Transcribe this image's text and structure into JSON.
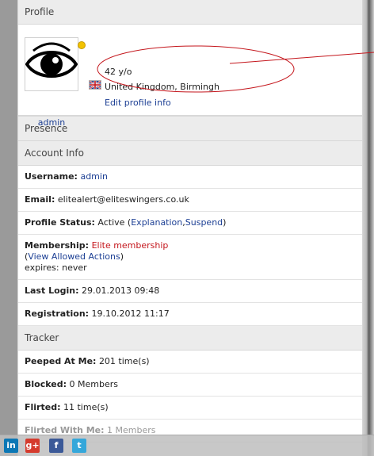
{
  "profile": {
    "header": "Profile",
    "username": "admin",
    "age": "42 y/o",
    "location": "United Kingdom, Birmingh",
    "edit_link": "Edit profile info"
  },
  "presence": {
    "header": "Presence"
  },
  "account": {
    "header": "Account Info",
    "username_label": "Username:",
    "username_value": "admin",
    "email_label": "Email:",
    "email_value": "elitealert@eliteswingers.co.uk",
    "status_label": "Profile Status:",
    "status_value": "Active (",
    "status_explanation": "Explanation",
    "status_comma": ",",
    "status_suspend": "Suspend",
    "status_close": ")",
    "membership_label": "Membership:",
    "membership_value": "Elite membership",
    "allowed_open": "(",
    "allowed_link": "View Allowed Actions",
    "allowed_close": ")",
    "expires": "expires: never",
    "last_login_label": "Last Login:",
    "last_login_value": "29.01.2013 09:48",
    "registration_label": "Registration:",
    "registration_value": "19.10.2012 11:17"
  },
  "tracker": {
    "header": "Tracker",
    "peeped_label": "Peeped At Me:",
    "peeped_value": "201 time(s)",
    "blocked_label": "Blocked:",
    "blocked_value": "0 Members",
    "flirted_label": "Flirted:",
    "flirted_value": "11 time(s)",
    "flirted_with_label": "Flirted With Me:",
    "flirted_with_value": "1 Members"
  },
  "share": {
    "icons": [
      "linkedin-icon",
      "google-plus-icon",
      "facebook-icon",
      "twitter-icon"
    ],
    "linkedin_text": "in",
    "gplus_text": "g+",
    "facebook_text": "f",
    "twitter_text": "t"
  },
  "colors": {
    "link": "#1c3f94",
    "membership": "#c4161c",
    "annotation": "#c4161c"
  }
}
